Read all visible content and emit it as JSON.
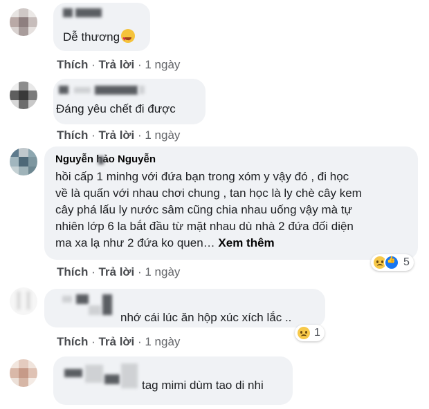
{
  "actions": {
    "like": "Thích",
    "reply": "Trả lời"
  },
  "comments": [
    {
      "text": "Dễ thương",
      "time": "1 ngày"
    },
    {
      "text": "Đáng yêu chết đi được",
      "time": "1 ngày"
    },
    {
      "name": "Nguyễn  hảo Nguyễn",
      "lines": [
        "hồi cấp 1 minhg với đứa bạn trong xóm y vậy đó , đi học",
        "về là quấn với nhau chơi chung , tan học là ly chè cây kem",
        "cây phá lấu ly nước sâm cũng chia nhau uống vậy mà tự",
        "nhiên lớp 6 la bắt đầu từ mặt nhau dù nhà 2 đứa đối diện",
        "ma xa lạ như 2 đứa ko quen… "
      ],
      "see_more": "Xem thêm",
      "reaction_count": "5",
      "time": "1 ngày"
    },
    {
      "text": "nhớ cái lúc ăn hộp xúc xích lắc ..",
      "reaction_count": "1",
      "time": "1 ngày"
    },
    {
      "text": "tag mimi dùm tao di nhi"
    }
  ],
  "icons": {
    "emoji_1": "heart-eyes-emoji",
    "sad": "sad-reaction-icon",
    "like": "like-reaction-icon"
  }
}
